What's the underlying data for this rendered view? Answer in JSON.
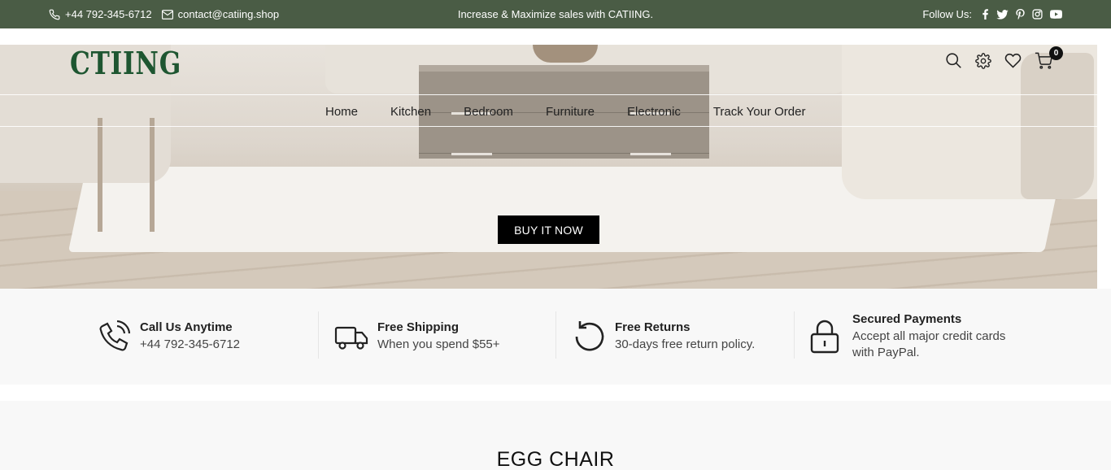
{
  "topbar": {
    "phone": "+44 792-345-6712",
    "email": "contact@catiing.shop",
    "promo": "Increase & Maximize sales with CATIING.",
    "follow_label": "Follow Us:",
    "social": [
      "facebook-icon",
      "twitter-icon",
      "pinterest-icon",
      "instagram-icon",
      "youtube-icon"
    ],
    "bg_color": "#4a5c45"
  },
  "header": {
    "logo": "CTIING",
    "logo_color": "#1e5631",
    "cart_count": "0"
  },
  "nav": {
    "items": [
      "Home",
      "Kitchen",
      "Bedroom",
      "Furniture",
      "Electronic",
      "Track Your Order"
    ]
  },
  "hero": {
    "cta": "BUY IT NOW"
  },
  "features": [
    {
      "title": "Call Us Anytime",
      "desc": "+44 792-345-6712",
      "icon": "phone-call-icon"
    },
    {
      "title": "Free Shipping",
      "desc": "When you spend $55+",
      "icon": "truck-icon"
    },
    {
      "title": "Free Returns",
      "desc": "30-days free return policy.",
      "icon": "return-icon"
    },
    {
      "title": "Secured Payments",
      "desc": "Accept all major credit cards with PayPal.",
      "icon": "lock-icon"
    }
  ],
  "section": {
    "title": "EGG CHAIR"
  }
}
